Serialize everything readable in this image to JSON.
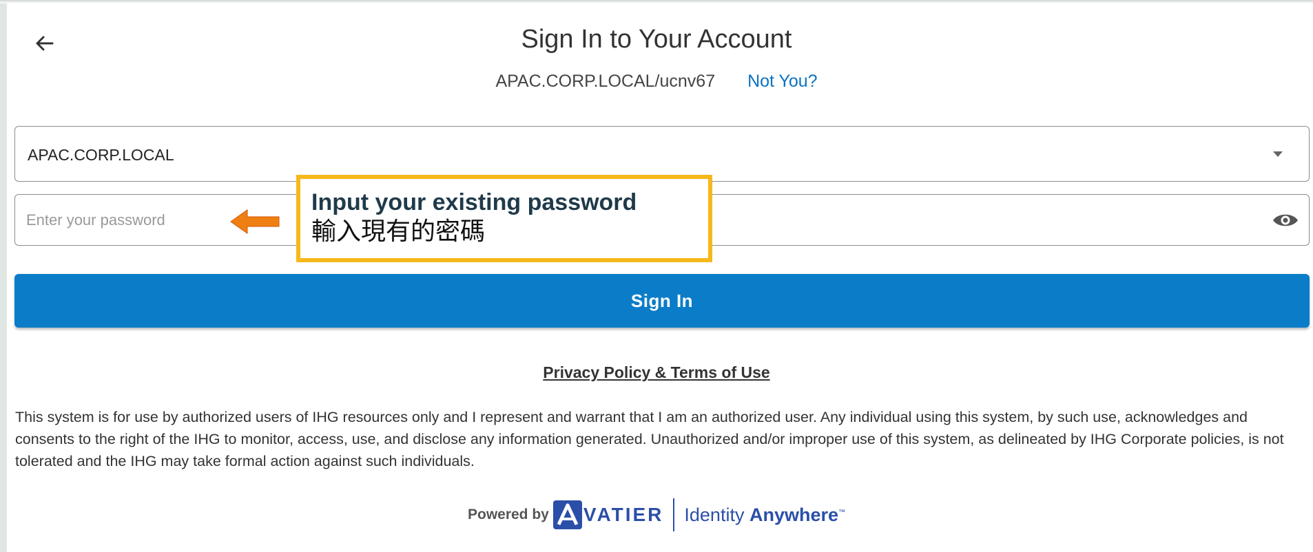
{
  "header": {
    "title": "Sign In to Your Account",
    "account": "APAC.CORP.LOCAL/ucnv67",
    "not_you": "Not You?"
  },
  "form": {
    "domain_selected": "APAC.CORP.LOCAL",
    "password_placeholder": "Enter your password",
    "sign_in_label": "Sign In"
  },
  "callout": {
    "english": "Input your existing password",
    "chinese": "輸入現有的密碼"
  },
  "footer": {
    "privacy_link": "Privacy Policy & Terms of Use",
    "notice": "This system is for use by authorized users of IHG resources only and I represent and warrant that I am an authorized user. Any individual using this system, by such use, acknowledges and consents to the right of the IHG to monitor, access, use, and disclose any information generated. Unauthorized and/or improper use of this system, as delineated by IHG Corporate policies, is not tolerated and the IHG may take formal action against such individuals.",
    "powered_by": "Powered by",
    "brand": "VATIER",
    "product_light": "Identity ",
    "product_bold": "Anywhere",
    "trademark": "™"
  },
  "colors": {
    "primary_button": "#0b7dc8",
    "link": "#0a72c2",
    "callout_border": "#f6b81a",
    "arrow": "#f07f12",
    "brand": "#2b4fa8"
  },
  "icons": {
    "back": "back-arrow-icon",
    "dropdown": "chevron-down-icon",
    "show_password": "eye-icon",
    "annotation": "arrow-left-icon",
    "brand_mark": "avatier-logo-icon"
  }
}
